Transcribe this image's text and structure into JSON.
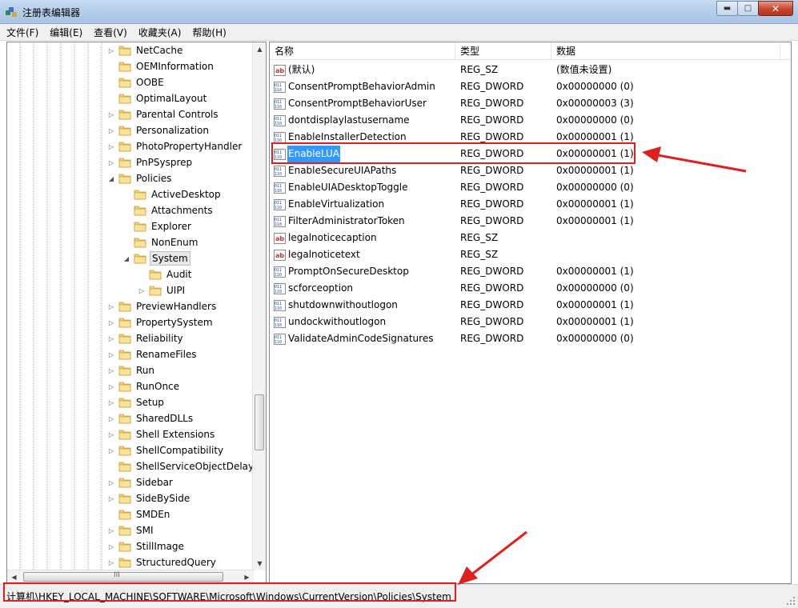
{
  "window": {
    "title": "注册表编辑器",
    "min_glyph": "▬",
    "max_glyph": "□",
    "close_glyph": "✕"
  },
  "menu": [
    "文件(F)",
    "编辑(E)",
    "查看(V)",
    "收藏夹(A)",
    "帮助(H)"
  ],
  "tree": {
    "nodes": [
      {
        "label": "NetCache",
        "expander": "▷"
      },
      {
        "label": "OEMInformation",
        "expander": ""
      },
      {
        "label": "OOBE",
        "expander": ""
      },
      {
        "label": "OptimalLayout",
        "expander": ""
      },
      {
        "label": "Parental Controls",
        "expander": "▷"
      },
      {
        "label": "Personalization",
        "expander": "▷"
      },
      {
        "label": "PhotoPropertyHandler",
        "expander": "▷"
      },
      {
        "label": "PnPSysprep",
        "expander": "▷"
      },
      {
        "label": "Policies",
        "expander": "◢"
      },
      {
        "label": "ActiveDesktop",
        "expander": ""
      },
      {
        "label": "Attachments",
        "expander": ""
      },
      {
        "label": "Explorer",
        "expander": ""
      },
      {
        "label": "NonEnum",
        "expander": ""
      },
      {
        "label": "System",
        "expander": "◢"
      },
      {
        "label": "Audit",
        "expander": ""
      },
      {
        "label": "UIPI",
        "expander": "▷"
      },
      {
        "label": "PreviewHandlers",
        "expander": "▷"
      },
      {
        "label": "PropertySystem",
        "expander": "▷"
      },
      {
        "label": "Reliability",
        "expander": "▷"
      },
      {
        "label": "RenameFiles",
        "expander": "▷"
      },
      {
        "label": "Run",
        "expander": "▷"
      },
      {
        "label": "RunOnce",
        "expander": "▷"
      },
      {
        "label": "Setup",
        "expander": "▷"
      },
      {
        "label": "SharedDLLs",
        "expander": "▷"
      },
      {
        "label": "Shell Extensions",
        "expander": "▷"
      },
      {
        "label": "ShellCompatibility",
        "expander": "▷"
      },
      {
        "label": "ShellServiceObjectDelayLoad",
        "expander": ""
      },
      {
        "label": "Sidebar",
        "expander": "▷"
      },
      {
        "label": "SideBySide",
        "expander": "▷"
      },
      {
        "label": "SMDEn",
        "expander": ""
      },
      {
        "label": "SMI",
        "expander": "▷"
      },
      {
        "label": "StillImage",
        "expander": "▷"
      },
      {
        "label": "StructuredQuery",
        "expander": "▷"
      }
    ],
    "scroll_up": "▲",
    "scroll_down": "▼",
    "scroll_left": "◀",
    "scroll_right": "▶",
    "thumb_grip": "III"
  },
  "list": {
    "headers": {
      "name": "名称",
      "type": "类型",
      "data": "数据"
    },
    "rows": [
      {
        "name": "(默认)",
        "type": "REG_SZ",
        "data": "(数值未设置)",
        "icon": "string-value-icon"
      },
      {
        "name": "ConsentPromptBehaviorAdmin",
        "type": "REG_DWORD",
        "data": "0x00000000 (0)",
        "icon": "dword-value-icon"
      },
      {
        "name": "ConsentPromptBehaviorUser",
        "type": "REG_DWORD",
        "data": "0x00000003 (3)",
        "icon": "dword-value-icon"
      },
      {
        "name": "dontdisplaylastusername",
        "type": "REG_DWORD",
        "data": "0x00000000 (0)",
        "icon": "dword-value-icon"
      },
      {
        "name": "EnableInstallerDetection",
        "type": "REG_DWORD",
        "data": "0x00000001 (1)",
        "icon": "dword-value-icon"
      },
      {
        "name": "EnableLUA",
        "type": "REG_DWORD",
        "data": "0x00000001 (1)",
        "icon": "dword-value-icon",
        "selected": true
      },
      {
        "name": "EnableSecureUIAPaths",
        "type": "REG_DWORD",
        "data": "0x00000001 (1)",
        "icon": "dword-value-icon"
      },
      {
        "name": "EnableUIADesktopToggle",
        "type": "REG_DWORD",
        "data": "0x00000000 (0)",
        "icon": "dword-value-icon"
      },
      {
        "name": "EnableVirtualization",
        "type": "REG_DWORD",
        "data": "0x00000001 (1)",
        "icon": "dword-value-icon"
      },
      {
        "name": "FilterAdministratorToken",
        "type": "REG_DWORD",
        "data": "0x00000001 (1)",
        "icon": "dword-value-icon"
      },
      {
        "name": "legalnoticecaption",
        "type": "REG_SZ",
        "data": "",
        "icon": "string-value-icon"
      },
      {
        "name": "legalnoticetext",
        "type": "REG_SZ",
        "data": "",
        "icon": "string-value-icon"
      },
      {
        "name": "PromptOnSecureDesktop",
        "type": "REG_DWORD",
        "data": "0x00000001 (1)",
        "icon": "dword-value-icon"
      },
      {
        "name": "scforceoption",
        "type": "REG_DWORD",
        "data": "0x00000000 (0)",
        "icon": "dword-value-icon"
      },
      {
        "name": "shutdownwithoutlogon",
        "type": "REG_DWORD",
        "data": "0x00000001 (1)",
        "icon": "dword-value-icon"
      },
      {
        "name": "undockwithoutlogon",
        "type": "REG_DWORD",
        "data": "0x00000001 (1)",
        "icon": "dword-value-icon"
      },
      {
        "name": "ValidateAdminCodeSignatures",
        "type": "REG_DWORD",
        "data": "0x00000000 (0)",
        "icon": "dword-value-icon"
      }
    ]
  },
  "status": {
    "path": "计算机\\HKEY_LOCAL_MACHINE\\SOFTWARE\\Microsoft\\Windows\\CurrentVersion\\Policies\\System"
  },
  "colors": {
    "selection": "#3399ff",
    "annotation": "#e02020"
  }
}
